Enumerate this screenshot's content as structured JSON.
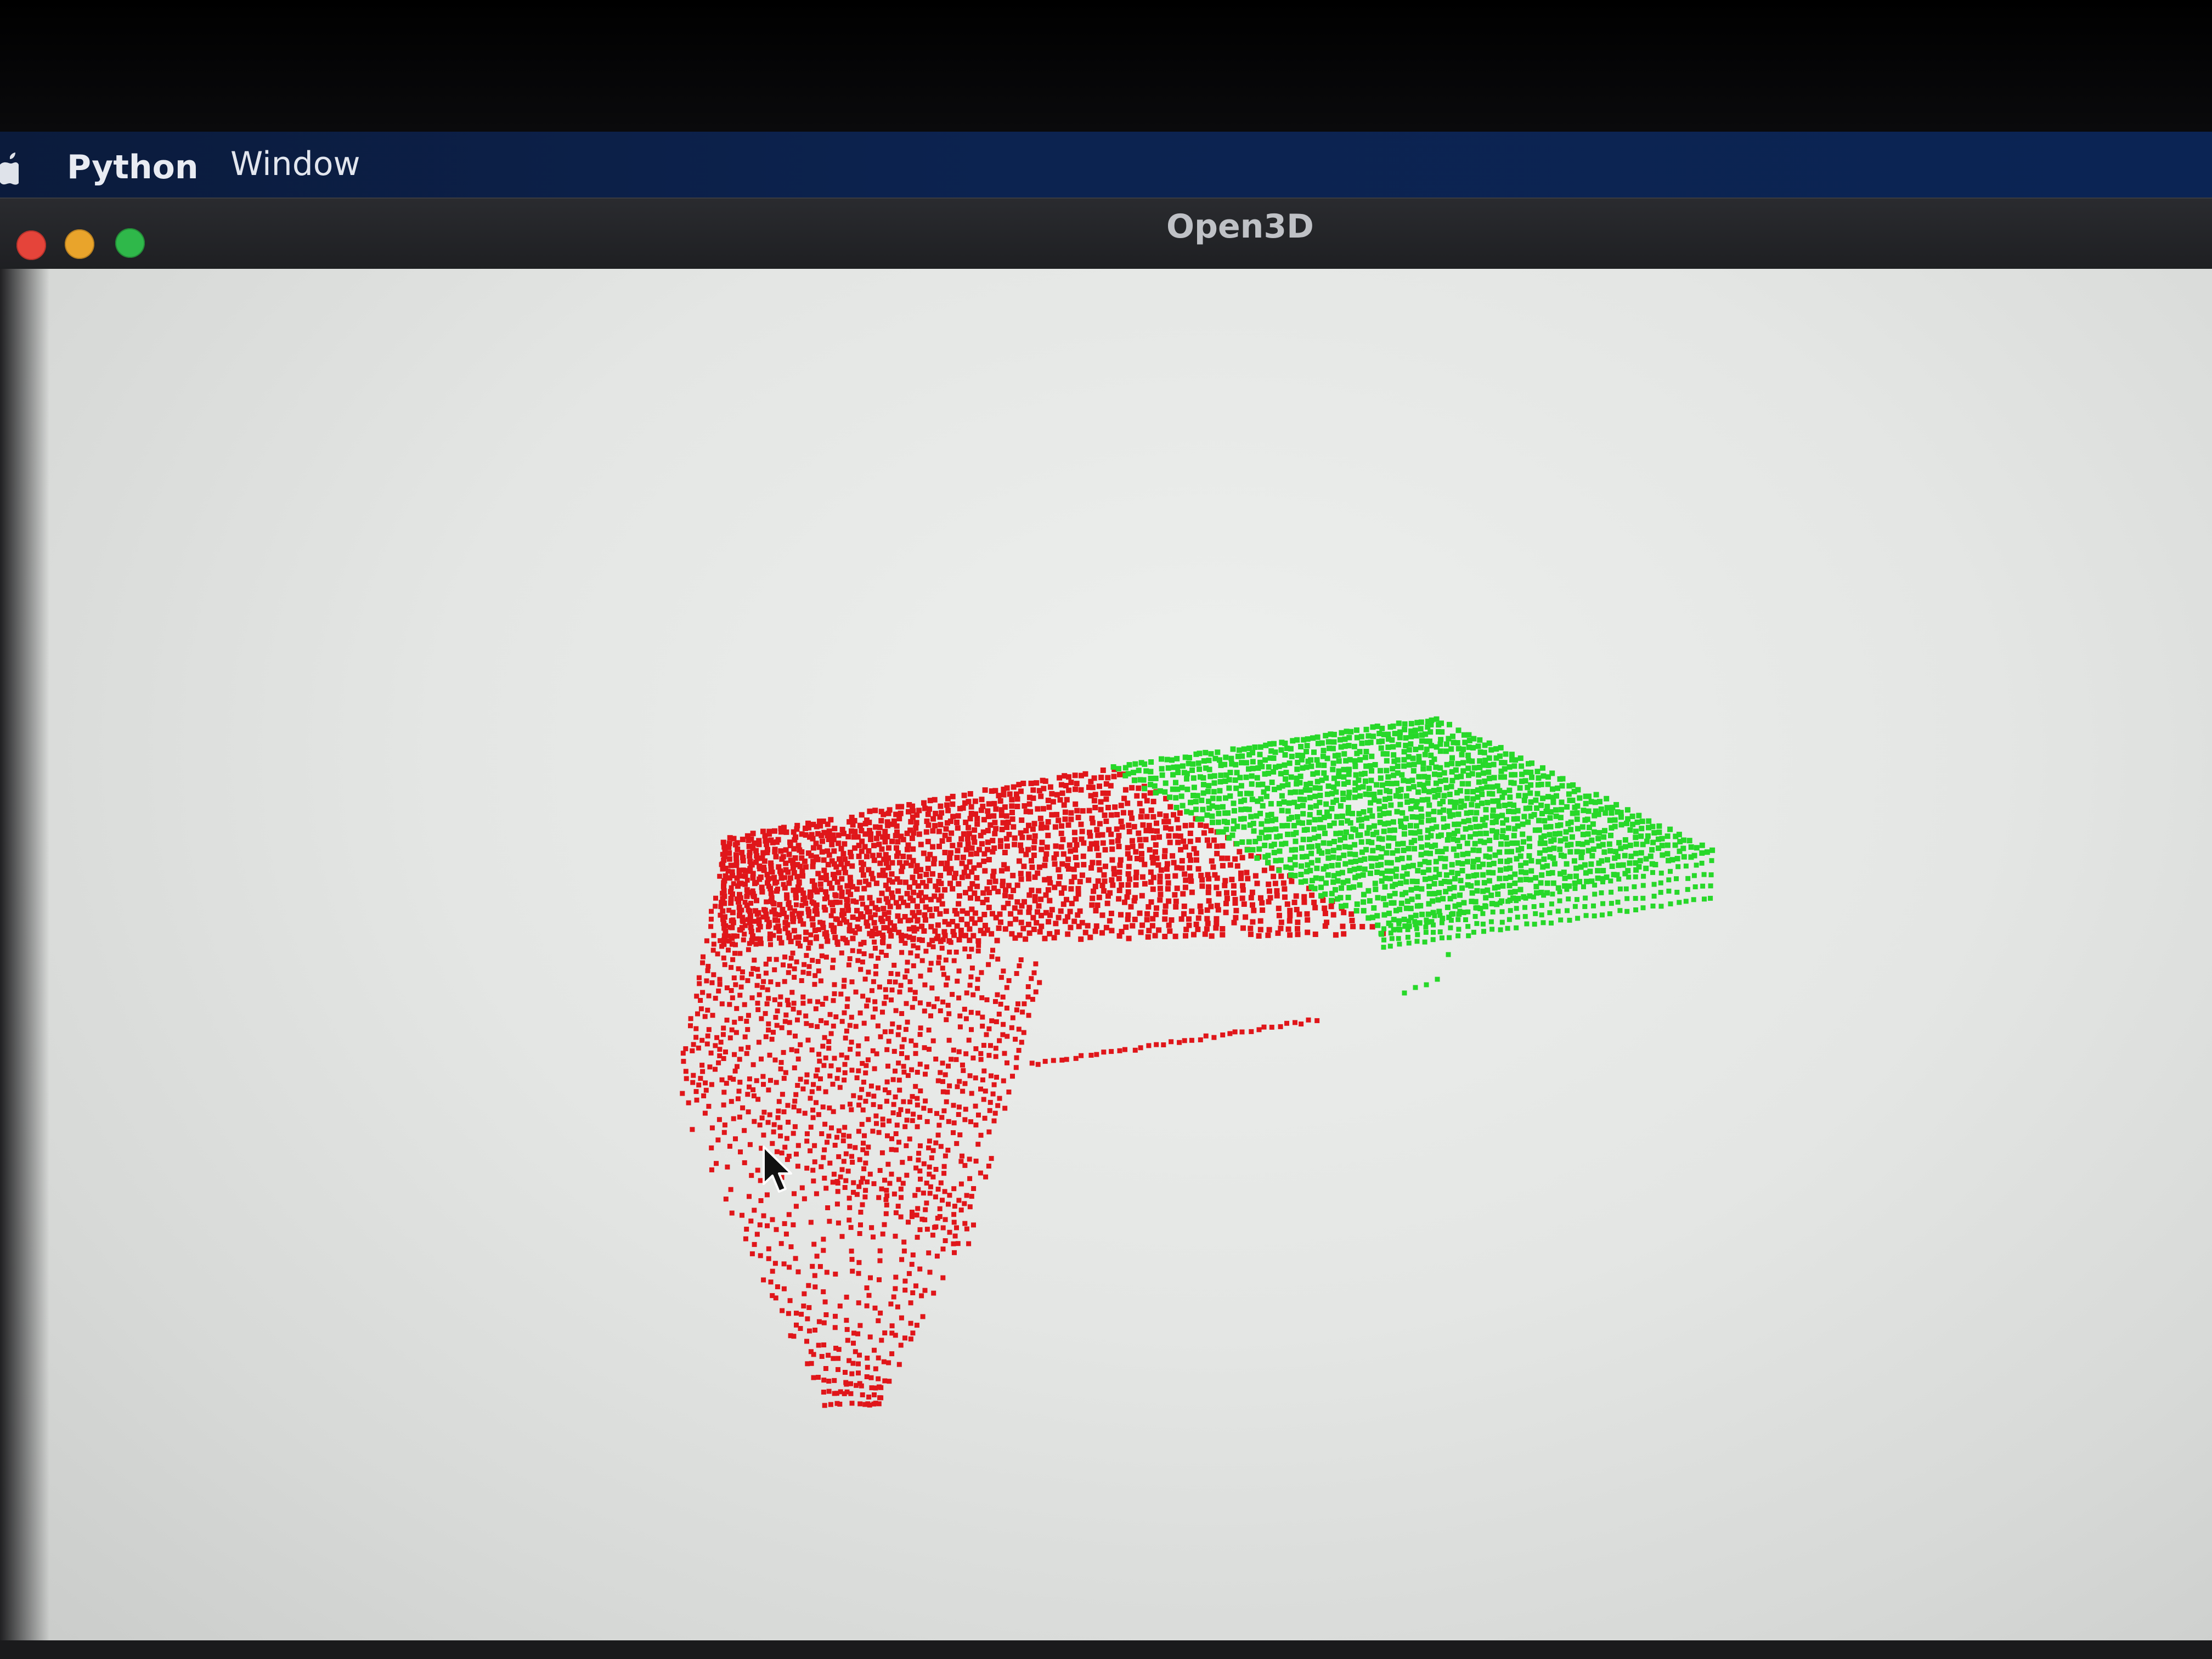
{
  "menubar": {
    "apple_icon": "apple-logo-icon",
    "items": [
      {
        "label": "Python"
      },
      {
        "label": "Window"
      }
    ]
  },
  "window": {
    "title": "Open3D",
    "controls": [
      "close-icon",
      "minimize-icon",
      "maximize-icon"
    ]
  },
  "viewer": {
    "background": "#e6e8e6",
    "point_clouds": [
      {
        "name": "red-cloud",
        "color": "#e0161a"
      },
      {
        "name": "green-cloud",
        "color": "#27d829"
      }
    ],
    "cursor_icon": "arrow-cursor-icon"
  }
}
